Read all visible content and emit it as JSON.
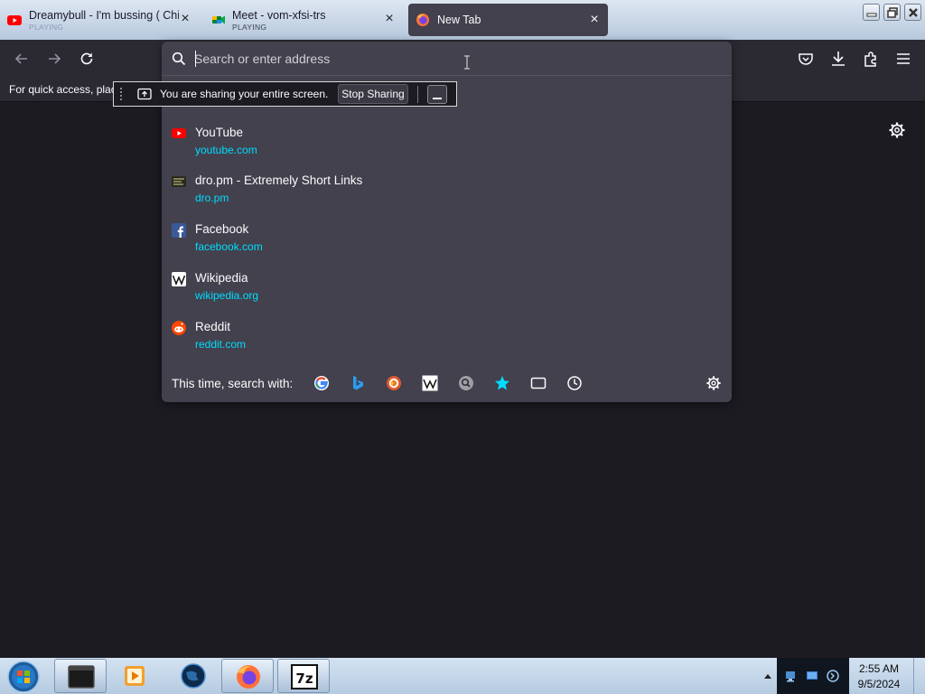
{
  "tabs": [
    {
      "title": "Dreamybull - I'm bussing ( Chip",
      "subtitle": "PLAYING",
      "icon": "youtube-icon",
      "close": "×"
    },
    {
      "title": "Meet - vom-xfsi-trs",
      "subtitle": "PLAYING",
      "icon": "google-meet-icon",
      "close": "×"
    },
    {
      "title": "New Tab",
      "subtitle": "",
      "icon": "firefox-icon",
      "close": "×"
    }
  ],
  "toolbar": {
    "bookmarks_hint": "For quick access, plac"
  },
  "urlbar": {
    "placeholder": "Search or enter address",
    "value": ""
  },
  "share_bar": {
    "text": "You are sharing your entire screen.",
    "stop_label": "Stop Sharing"
  },
  "results": [
    {
      "title": "YouTube",
      "url": "youtube.com",
      "icon": "youtube-icon"
    },
    {
      "title": "dro.pm - Extremely Short Links",
      "url": "dro.pm",
      "icon": "dropm-icon"
    },
    {
      "title": "Facebook",
      "url": "facebook.com",
      "icon": "facebook-icon"
    },
    {
      "title": "Wikipedia",
      "url": "wikipedia.org",
      "icon": "wikipedia-icon"
    },
    {
      "title": "Reddit",
      "url": "reddit.com",
      "icon": "reddit-icon"
    }
  ],
  "oneoff": {
    "label": "This time, search with:",
    "engines": [
      "google-icon",
      "bing-icon",
      "duckduckgo-icon",
      "wikipedia-icon",
      "search-engine-icon",
      "bookmarks-star-icon",
      "tabs-icon",
      "history-icon"
    ]
  },
  "taskbar": {
    "time": "2:55 AM",
    "date": "9/5/2024",
    "apps": [
      "terminal-icon",
      "media-player-icon",
      "globe-icon",
      "firefox-icon",
      "7zip-icon"
    ]
  },
  "colors": {
    "link": "#00ddff",
    "panel": "#42414d",
    "toolbar": "#2b2a33",
    "content": "#1c1b22"
  }
}
